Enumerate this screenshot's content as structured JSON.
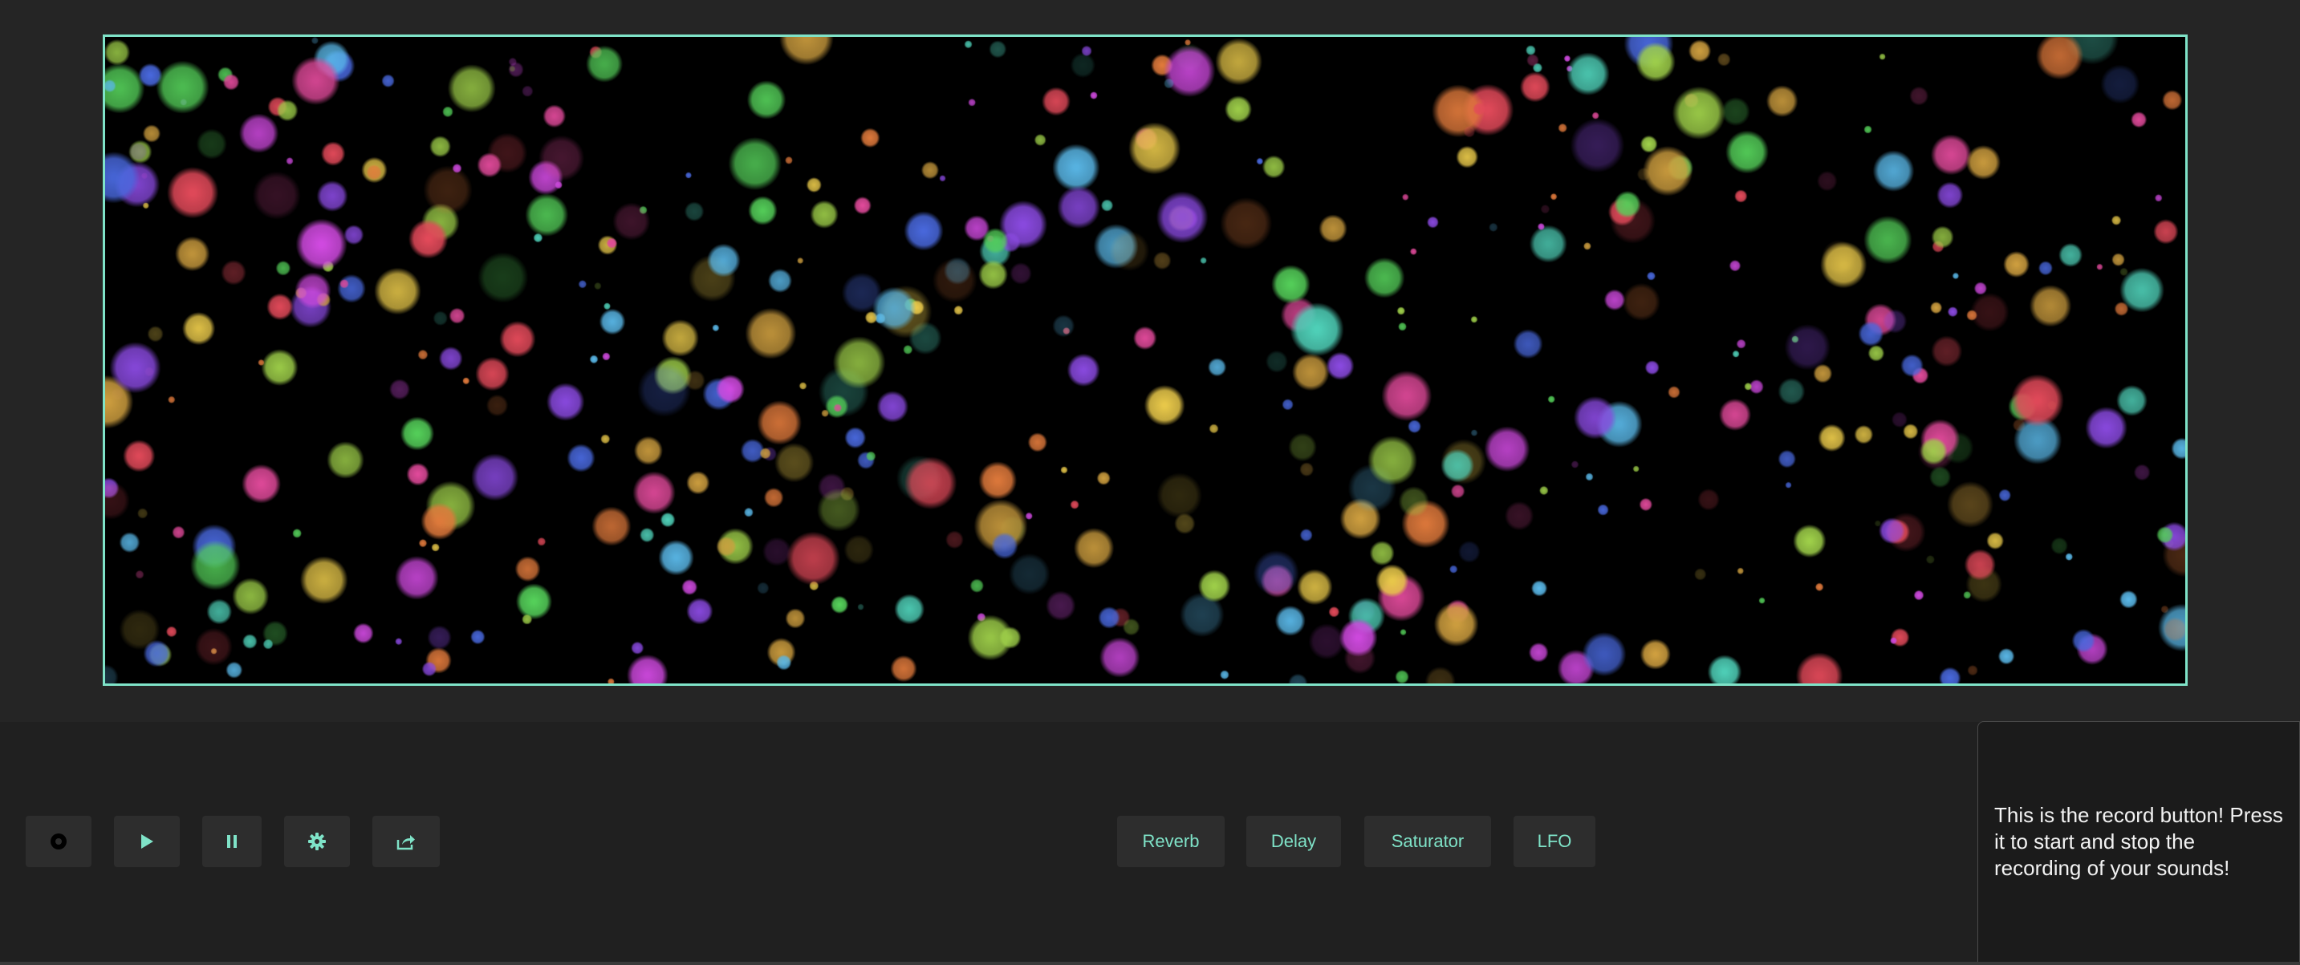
{
  "app": {
    "accent_color": "#7fe3c8",
    "background_color": "#252525",
    "canvas_background": "#000000"
  },
  "visualizer": {
    "description_icon": "bubbles-visualizer",
    "bubble_palette": [
      "#e24a5a",
      "#e07a3c",
      "#e8c84a",
      "#9fd04a",
      "#55d05a",
      "#4fd0b8",
      "#5ab8e8",
      "#4a6ae0",
      "#8a4ae0",
      "#d04ae0",
      "#e04a9a",
      "#d0a040"
    ]
  },
  "controls": {
    "record": {
      "icon": "record-icon"
    },
    "play": {
      "icon": "play-icon"
    },
    "pause": {
      "icon": "pause-icon"
    },
    "settings": {
      "icon": "gear-icon"
    },
    "share": {
      "icon": "share-icon"
    }
  },
  "effects": [
    {
      "label": "Reverb"
    },
    {
      "label": "Delay"
    },
    {
      "label": "Saturator"
    },
    {
      "label": "LFO"
    }
  ],
  "tooltip": {
    "text": "This is the record button! Press it to start and stop the recording of your sounds!"
  }
}
